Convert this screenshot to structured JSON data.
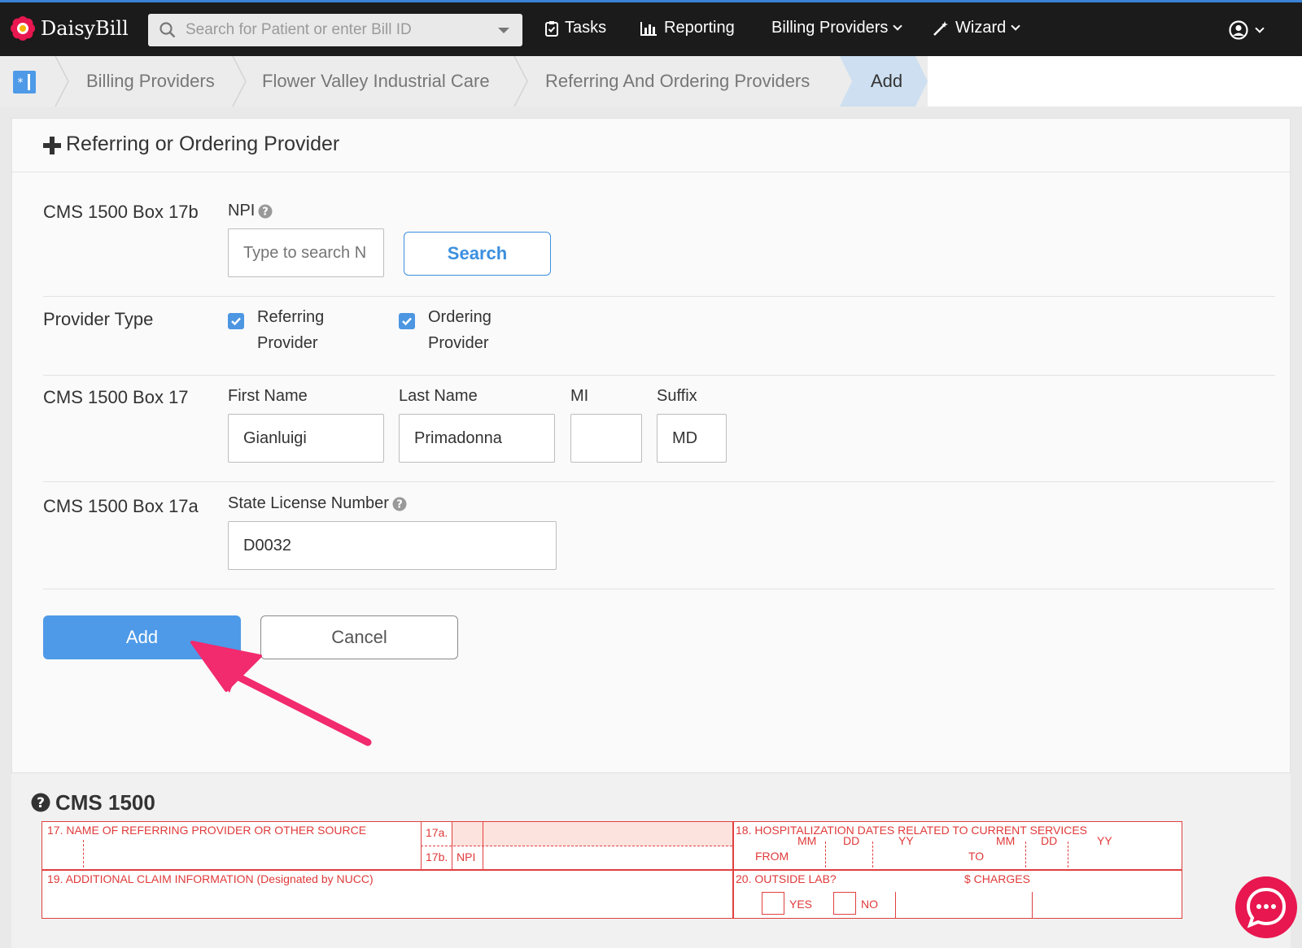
{
  "app": {
    "name": "DaisyBill",
    "brand_color": "#e8174f",
    "accent_color": "#4e9ae8"
  },
  "topbar": {
    "search_placeholder": "Search for Patient or enter Bill ID",
    "nav": {
      "tasks": "Tasks",
      "reporting": "Reporting",
      "billing_providers": "Billing Providers",
      "wizard": "Wizard"
    }
  },
  "breadcrumb": {
    "items": [
      "Billing Providers",
      "Flower Valley Industrial Care",
      "Referring And Ordering Providers"
    ],
    "active": "Add"
  },
  "form": {
    "title": "Referring or Ordering Provider",
    "npi_row": {
      "label": "CMS 1500 Box 17b",
      "field_label": "NPI",
      "placeholder": "Type to search N",
      "search_button": "Search"
    },
    "provider_type": {
      "label": "Provider Type",
      "options": [
        {
          "line1": "Referring",
          "line2": "Provider",
          "checked": true
        },
        {
          "line1": "Ordering",
          "line2": "Provider",
          "checked": true
        }
      ]
    },
    "name_row": {
      "label": "CMS 1500 Box 17",
      "first_name_label": "First Name",
      "first_name": "Gianluigi",
      "last_name_label": "Last Name",
      "last_name": "Primadonna",
      "mi_label": "MI",
      "mi": "",
      "suffix_label": "Suffix",
      "suffix": "MD"
    },
    "license_row": {
      "label": "CMS 1500 Box 17a",
      "field_label": "State License Number",
      "value": "D0032"
    },
    "add_button": "Add",
    "cancel_button": "Cancel"
  },
  "cms1500": {
    "title": "CMS 1500",
    "box17": "17. NAME OF REFERRING PROVIDER OR OTHER SOURCE",
    "box17a": "17a.",
    "box17b": "17b.",
    "npi": "NPI",
    "box18": "18. HOSPITALIZATION DATES RELATED TO CURRENT SERVICES",
    "mm1": "MM",
    "dd1": "DD",
    "yy1": "YY",
    "from": "FROM",
    "mm2": "MM",
    "dd2": "DD",
    "yy2": "YY",
    "to": "TO",
    "box19": "19. ADDITIONAL CLAIM INFORMATION (Designated by NUCC)",
    "box20": "20. OUTSIDE LAB?",
    "charges": "$ CHARGES",
    "yes": "YES",
    "no": "NO"
  }
}
